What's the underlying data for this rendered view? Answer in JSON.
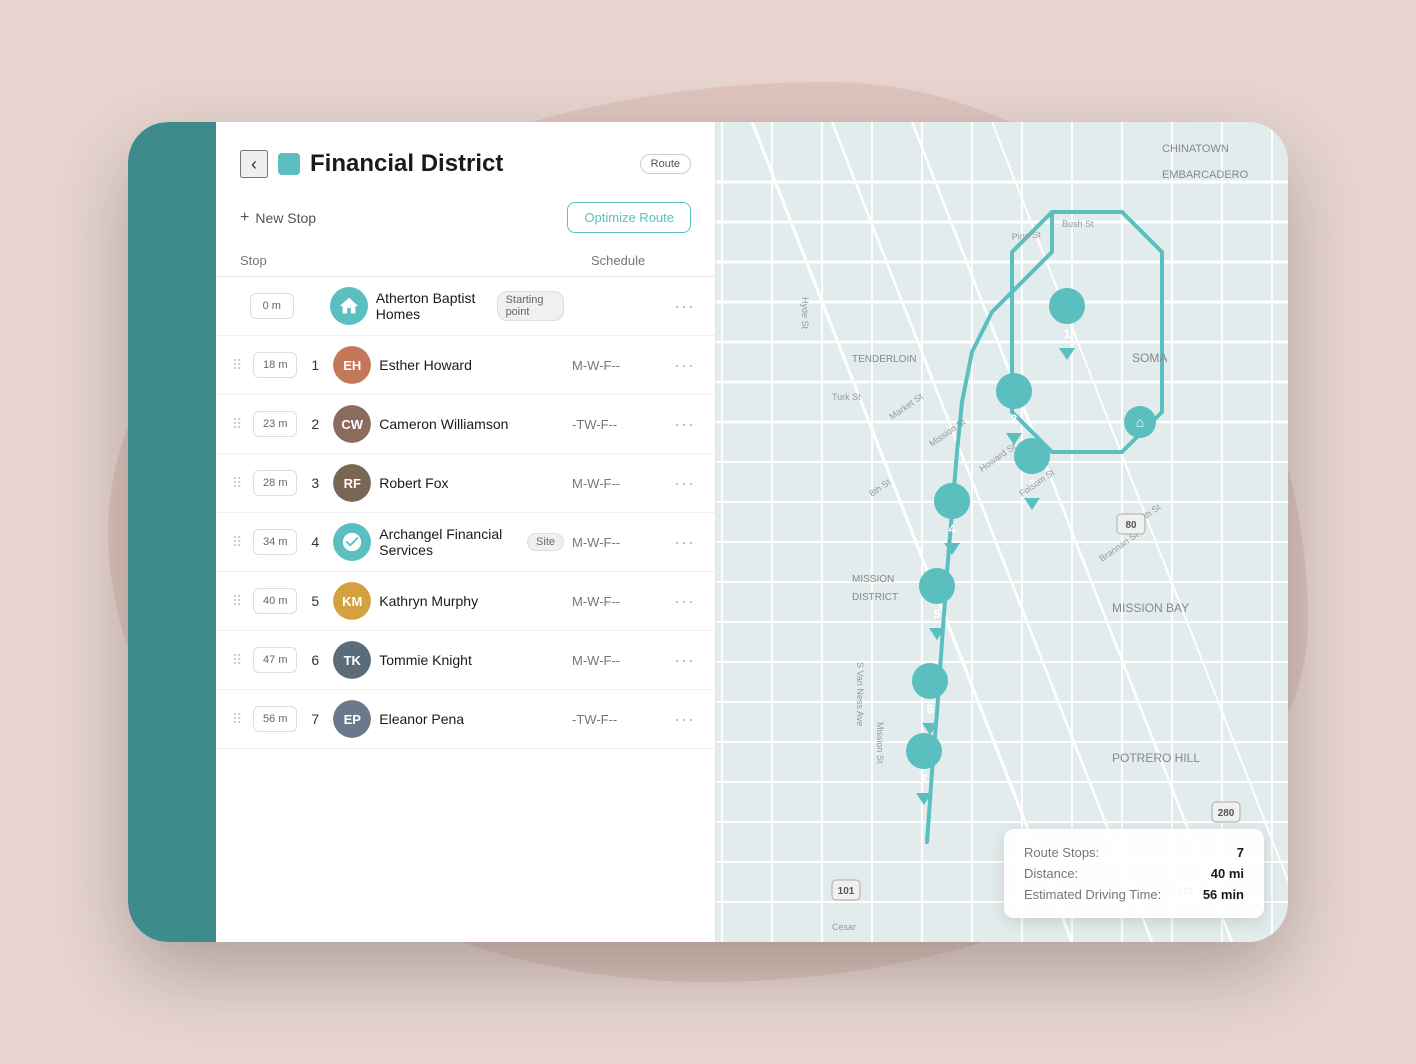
{
  "app": {
    "title": "Financial District",
    "route_badge": "Route"
  },
  "toolbar": {
    "new_stop_label": "New Stop",
    "optimize_label": "Optimize Route"
  },
  "table": {
    "col_stop": "Stop",
    "col_schedule": "Schedule"
  },
  "stops": [
    {
      "id": 0,
      "distance": "0 m",
      "number": "",
      "name": "Atherton Baptist Homes",
      "tag": "Starting point",
      "schedule": "",
      "type": "home"
    },
    {
      "id": 1,
      "distance": "18 m",
      "number": "1",
      "name": "Esther Howard",
      "tag": "",
      "schedule": "M-W-F--",
      "type": "person",
      "avatar_class": "avatar-esther",
      "initials": "EH"
    },
    {
      "id": 2,
      "distance": "23 m",
      "number": "2",
      "name": "Cameron Williamson",
      "tag": "",
      "schedule": "-TW-F--",
      "type": "person",
      "avatar_class": "avatar-cameron",
      "initials": "CW"
    },
    {
      "id": 3,
      "distance": "28 m",
      "number": "3",
      "name": "Robert Fox",
      "tag": "",
      "schedule": "M-W-F--",
      "type": "person",
      "avatar_class": "avatar-robert",
      "initials": "RF"
    },
    {
      "id": 4,
      "distance": "34 m",
      "number": "4",
      "name": "Archangel Financial Services",
      "tag": "Site",
      "schedule": "M-W-F--",
      "type": "site"
    },
    {
      "id": 5,
      "distance": "40 m",
      "number": "5",
      "name": "Kathryn Murphy",
      "tag": "",
      "schedule": "M-W-F--",
      "type": "person",
      "avatar_class": "avatar-kathryn",
      "initials": "KM"
    },
    {
      "id": 6,
      "distance": "47 m",
      "number": "6",
      "name": "Tommie Knight",
      "tag": "",
      "schedule": "M-W-F--",
      "type": "person",
      "avatar_class": "avatar-tommie",
      "initials": "TK"
    },
    {
      "id": 7,
      "distance": "56 m",
      "number": "7",
      "name": "Eleanor Pena",
      "tag": "",
      "schedule": "-TW-F--",
      "type": "person",
      "avatar_class": "avatar-eleanor",
      "initials": "EP"
    }
  ],
  "route_info": {
    "stops_label": "Route Stops:",
    "stops_value": "7",
    "distance_label": "Distance:",
    "distance_value": "40 mi",
    "driving_time_label": "Estimated Driving Time:",
    "driving_time_value": "56 min"
  },
  "map": {
    "teal_color": "#5bbfbf",
    "road_color": "#ffffff",
    "land_color": "#e8ecec",
    "water_color": "#c5d5d5"
  }
}
